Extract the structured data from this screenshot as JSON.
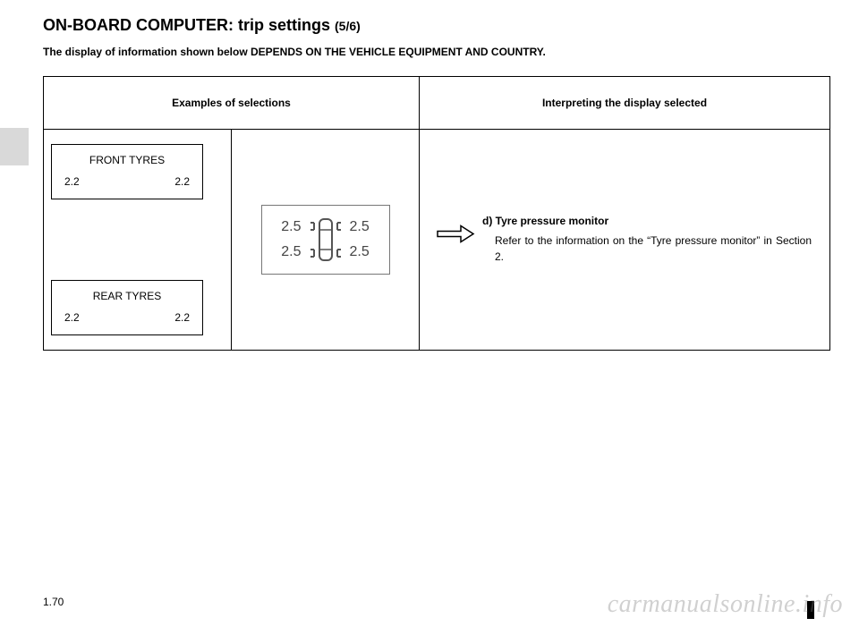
{
  "title_main": "ON-BOARD COMPUTER: trip settings ",
  "title_sub": "(5/6)",
  "subtitle": "The display of information shown below DEPENDS ON THE VEHICLE EQUIPMENT AND COUNTRY.",
  "table": {
    "header_left": "Examples of selections",
    "header_right": "Interpreting the display selected"
  },
  "front_tyres": {
    "label": "FRONT TYRES",
    "left": "2.2",
    "right": "2.2"
  },
  "rear_tyres": {
    "label": "REAR TYRES",
    "left": "2.2",
    "right": "2.2"
  },
  "diagram": {
    "fl": "2.5",
    "fr": "2.5",
    "rl": "2.5",
    "rr": "2.5"
  },
  "interpretation": {
    "heading": "d) Tyre pressure monitor",
    "body": "Refer to the information on the “Tyre pressure monitor” in Section 2."
  },
  "page_number": "1.70",
  "watermark": "carmanualsonline.info"
}
